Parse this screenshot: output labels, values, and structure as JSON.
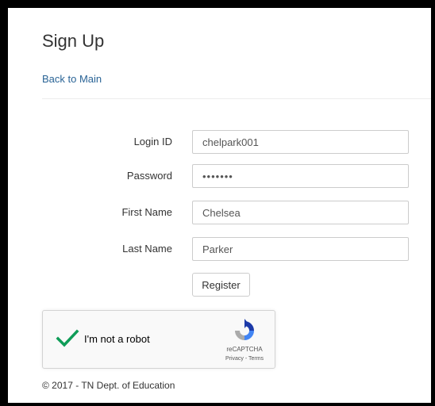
{
  "page": {
    "title": "Sign Up",
    "back_link": "Back to Main"
  },
  "form": {
    "fields": [
      {
        "label": "Login ID",
        "value": "chelpark001"
      },
      {
        "label": "Password",
        "value": "•••••••"
      },
      {
        "label": "First Name",
        "value": "Chelsea"
      },
      {
        "label": "Last Name",
        "value": "Parker"
      }
    ],
    "register_label": "Register"
  },
  "recaptcha": {
    "label": "I'm not a robot",
    "brand": "reCAPTCHA",
    "privacy": "Privacy",
    "separator": " - ",
    "terms": "Terms",
    "check_color": "#0F9D58",
    "logo_blue": "#1C3AA9",
    "logo_light": "#4285F4",
    "logo_gray": "#ABABAB"
  },
  "footer": {
    "text": "© 2017 - TN Dept. of Education"
  }
}
